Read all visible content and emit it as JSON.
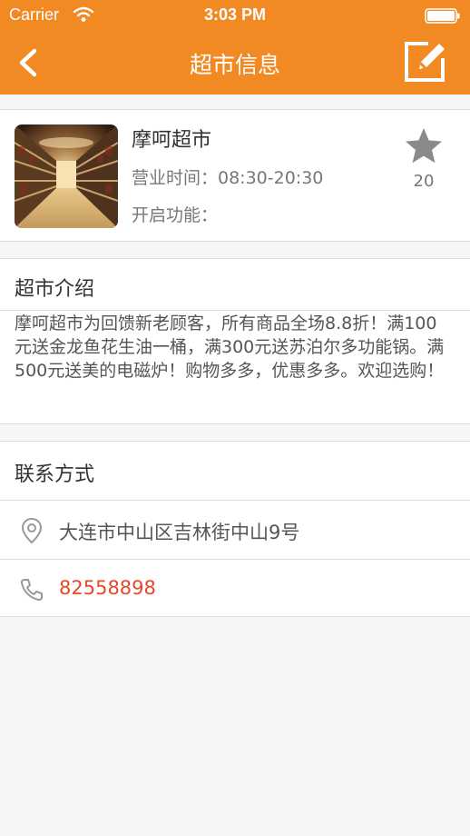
{
  "status_bar": {
    "carrier": "Carrier",
    "time": "3:03 PM"
  },
  "nav": {
    "title": "超市信息",
    "back_icon": "chevron-left-icon",
    "edit_icon": "edit-icon"
  },
  "store": {
    "name": "摩呵超市",
    "hours": "营业时间：08:30-20:30",
    "features": "开启功能：",
    "favorite_count": "20"
  },
  "intro": {
    "title": "超市介绍",
    "body": "摩呵超市为回馈新老顾客，所有商品全场8.8折！满100元送金龙鱼花生油一桶，满300元送苏泊尔多功能锅。满500元送美的电磁炉！购物多多，优惠多多。欢迎选购！"
  },
  "contact": {
    "title": "联系方式",
    "address": "大连市中山区吉林街中山9号",
    "phone": "82558898"
  },
  "colors": {
    "accent": "#f28a24",
    "phone": "#e8482a"
  }
}
